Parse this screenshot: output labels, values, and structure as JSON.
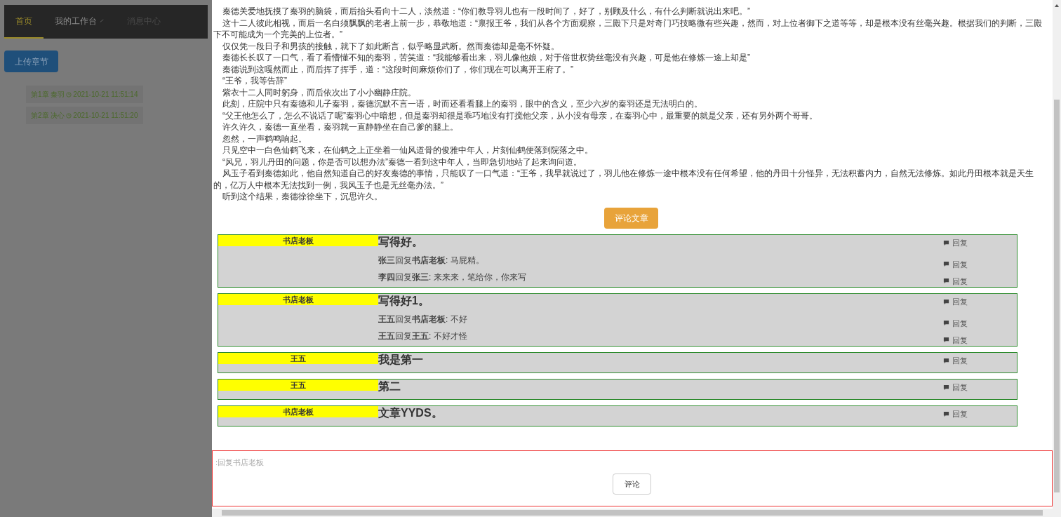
{
  "nav": {
    "tabs": [
      {
        "label": "首页",
        "selected": true,
        "dropdown": false
      },
      {
        "label": "我的工作台",
        "selected": false,
        "dropdown": true
      },
      {
        "label": "消息中心",
        "selected": false,
        "dropdown": false
      }
    ]
  },
  "upload_button": "上传章节",
  "chapters": [
    {
      "title": "第1章 秦羽",
      "time": "2021-10-21 11:51:14"
    },
    {
      "title": "第2章 决心",
      "time": "2021-10-21 11:51:20"
    }
  ],
  "article": {
    "paragraphs": [
      "秦德关爱地抚摸了秦羽的脑袋，而后抬头看向十二人，淡然道：“你们教导羽儿也有一段时间了，好了，别顾及什么，有什么判断就说出来吧。”",
      "这十二人彼此相视，而后一名白须飘飘的老者上前一步，恭敬地道：“禀报王爷，我们从各个方面观察，三殿下只是对奇门巧技略微有些兴趣，然而，对上位者御下之道等等，却是根本没有丝毫兴趣。根据我们的判断，三殿下不可能成为一个完美的上位者。”",
      "仅仅凭一段日子和男孩的接触，就下了如此断言，似乎略显武断。然而秦德却是毫不怀疑。",
      "秦德长长叹了一口气，看了看懵懂不知的秦羽，苦笑道：“我能够看出来，羽儿像他娘，对于俗世权势丝毫没有兴趣，可是他在修炼一途上却是”",
      "秦德说到这嘎然而止，而后挥了挥手，道：“这段时间麻烦你们了，你们现在可以离开王府了。”",
      "“王爷，我等告辞”",
      "紫衣十二人同时躬身，而后依次出了小小幽静庄院。",
      "此刻，庄院中只有秦德和儿子秦羽，秦德沉默不言一语，时而还看看腿上的秦羽，眼中的含义，至少六岁的秦羽还是无法明白的。",
      "“父王他怎么了，怎么不说话了呢”秦羽心中暗想，但是秦羽却很是乖巧地没有打搅他父亲，从小没有母亲，在秦羽心中，最重要的就是父亲，还有另外两个哥哥。",
      "许久许久，秦德一直坐看，秦羽就一直静静坐在自己爹的腿上。",
      "忽然，一声鹤鸣响起。",
      "只见空中一白色仙鹤飞来，在仙鹤之上正坐着一仙风道骨的俊雅中年人，片刻仙鹤便落到院落之中。",
      "“风兄，羽儿丹田的问题，你是否可以想办法”秦德一看到这中年人，当即急切地站了起来询问道。",
      "风玉子看到秦德如此，他自然知道自己的好友秦德的事情，只能叹了一口气道：“王爷，我早就说过了，羽儿他在修炼一途中根本没有任何希望，他的丹田十分怪异，无法积蓄内力，自然无法修炼。如此丹田根本就是天生的，亿万人中根本无法找到一例，我风玉子也是无丝毫办法。”",
      "听到这个结果，秦德徐徐坐下，沉思许久。"
    ]
  },
  "comment_article_button": "评论文章",
  "comments": [
    {
      "author": "书店老板",
      "text": "写得好。",
      "reply_link": "回复",
      "replies": [
        {
          "from": "张三",
          "verb": "回复",
          "to": "书店老板",
          "content": ": 马屁精。",
          "reply_link": "回复"
        },
        {
          "from": "李四",
          "verb": "回复",
          "to": "张三",
          "content": ": 来来来，笔给你，你来写",
          "reply_link": "回复"
        }
      ]
    },
    {
      "author": "书店老板",
      "text": "写得好1。",
      "reply_link": "回复",
      "replies": [
        {
          "from": "王五",
          "verb": "回复",
          "to": "书店老板",
          "content": ": 不好",
          "reply_link": "回复"
        },
        {
          "from": "王五",
          "verb": "回复",
          "to": "王五",
          "content": ": 不好才怪",
          "reply_link": "回复"
        }
      ]
    },
    {
      "author": "王五",
      "text": "我是第一",
      "reply_link": "回复"
    },
    {
      "author": "王五",
      "text": "第二",
      "reply_link": "回复"
    },
    {
      "author": "书店老板",
      "text": "文章YYDS。",
      "reply_link": "回复"
    }
  ],
  "reply_box": {
    "placeholder": ":回复书店老板",
    "submit": "评论"
  }
}
